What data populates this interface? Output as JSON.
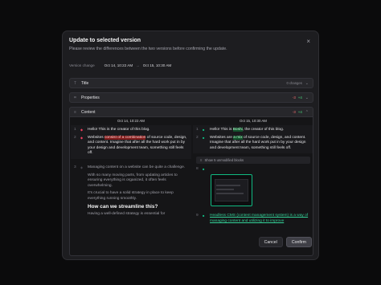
{
  "dialog": {
    "title": "Update to selected version",
    "close_glyph": "×",
    "subtitle": "Please review the differences between the two versions before confirming the update.",
    "version_change_label": "Version change",
    "from_version": "Oct 14, 10:22 AM",
    "arrow": "→",
    "to_version": "Oct 15, 10:30 AM"
  },
  "sections": [
    {
      "label": "Title",
      "icon": "T",
      "meta": "0 changes",
      "chevron": "⌄"
    },
    {
      "label": "Properties",
      "icon": "⌗",
      "minus": "-3",
      "plus": "+4",
      "chevron": "⌄"
    },
    {
      "label": "Content",
      "icon": "≡",
      "minus": "-3",
      "plus": "+4",
      "chevron": "⌃"
    }
  ],
  "diff": {
    "left_header": "Oct 14, 10:22 AM",
    "right_header": "Oct 15, 10:30 AM",
    "left": {
      "l1_num": "1",
      "l1_pre": "Hello! This is the creator of this blog.",
      "l2_num": "2",
      "l2_pre": "Websites ",
      "l2_del": "consist of a combination",
      "l2_post": " of source code, design, and content. Imagine that after all the hard work put in by your design and development team, something still feels off.",
      "l3_num": "3",
      "l3": "Managing content on a website can be quite a challenge.",
      "l4": "With so many moving parts, from updating articles to ensuring everything is organized, it often feels overwhelming.",
      "l5": "It's crucial to have a solid strategy in place to keep everything running smoothly.",
      "l6": "How can we streamline this?",
      "l7": "Having a well-defined strategy is essential for"
    },
    "right": {
      "r1_num": "1",
      "r1_pre": "Hello! This is ",
      "r1_add": "Boshi",
      "r1_post": ", the creator of this blog.",
      "r2_num": "2",
      "r2_pre": "Websites are ",
      "r2_add": "a mix",
      "r2_post": " of source code, design, and content. Imagine that after all the hard work put in by your design and development team, something still feels off.",
      "unmodified": "Show 5 unmodified blocks",
      "r3_num": "8",
      "r4_num": "9",
      "r4": "Headless CMS (content management system) is a way of managing content and utilizing it to improve"
    }
  },
  "footer": {
    "cancel_label": "Cancel",
    "confirm_label": "Confirm"
  },
  "colors": {
    "removed": "#f43f5e",
    "added": "#10b981",
    "background": "#1d1d20"
  }
}
